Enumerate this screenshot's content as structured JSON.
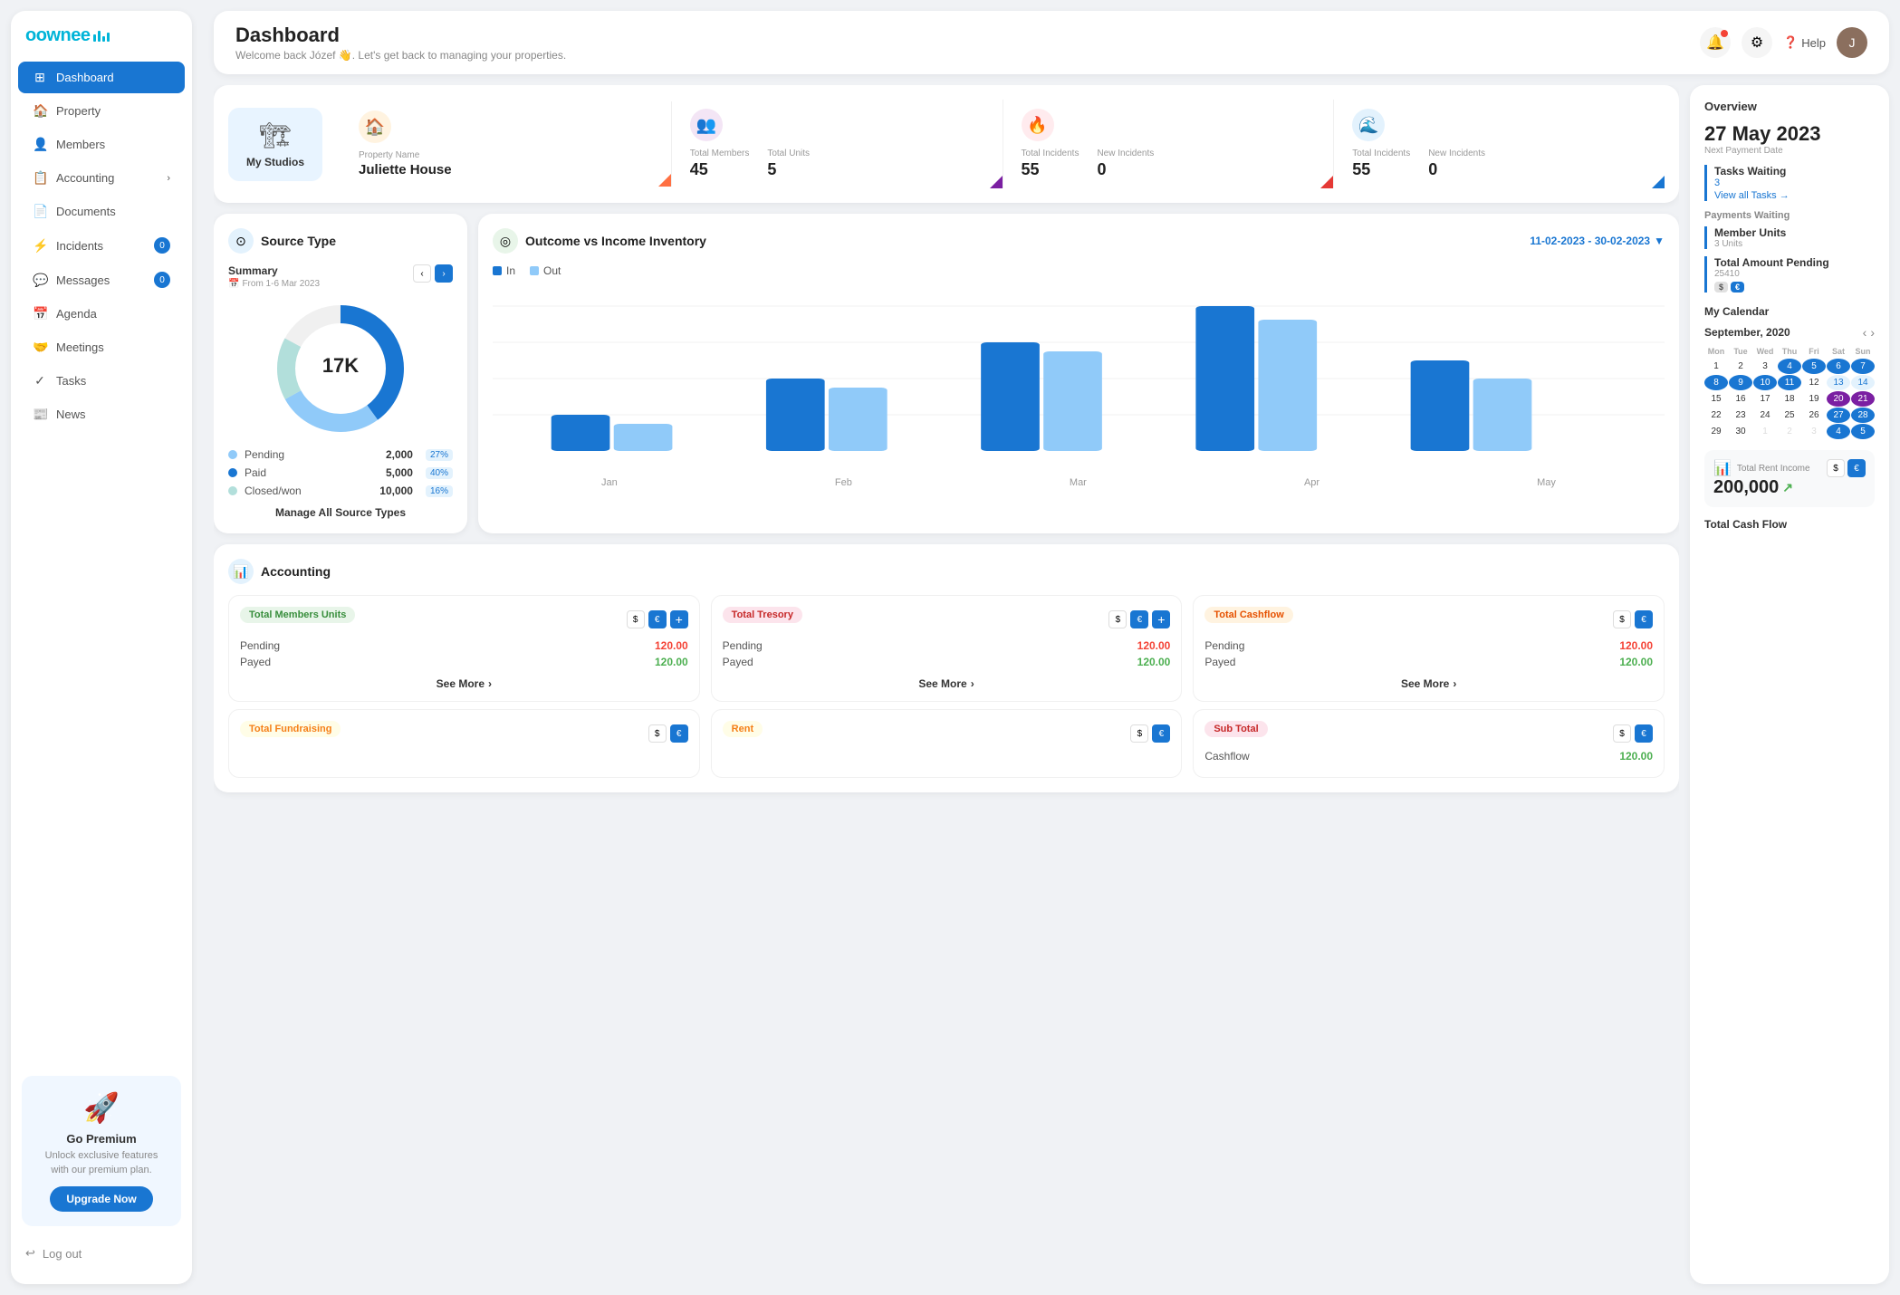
{
  "app": {
    "logo": "oownee",
    "logo_bars": "|||"
  },
  "header": {
    "title": "Dashboard",
    "subtitle": "Welcome back Józef 👋. Let's get back to managing your properties."
  },
  "sidebar": {
    "items": [
      {
        "label": "Dashboard",
        "icon": "⊞",
        "active": true,
        "badge": null
      },
      {
        "label": "Property",
        "icon": "🏠",
        "active": false,
        "badge": null
      },
      {
        "label": "Members",
        "icon": "👤",
        "active": false,
        "badge": null
      },
      {
        "label": "Accounting",
        "icon": "📋",
        "active": false,
        "badge": null,
        "arrow": ">"
      },
      {
        "label": "Documents",
        "icon": "📄",
        "active": false,
        "badge": null
      },
      {
        "label": "Incidents",
        "icon": "⚡",
        "active": false,
        "badge": "0"
      },
      {
        "label": "Messages",
        "icon": "💬",
        "active": false,
        "badge": "0"
      },
      {
        "label": "Agenda",
        "icon": "📅",
        "active": false,
        "badge": null
      },
      {
        "label": "Meetings",
        "icon": "🤝",
        "active": false,
        "badge": null
      },
      {
        "label": "Tasks",
        "icon": "✓",
        "active": false,
        "badge": null
      },
      {
        "label": "News",
        "icon": "📰",
        "active": false,
        "badge": null
      }
    ],
    "premium": {
      "title": "Go Premium",
      "description": "Unlock exclusive features with our premium plan.",
      "button": "Upgrade Now"
    },
    "logout": "Log out"
  },
  "property_row": {
    "my_studios": "My Studios",
    "cards": [
      {
        "icon": "🏠",
        "icon_color": "#ff7043",
        "label": "Property Name",
        "value": "Juliette House",
        "badge": "orange"
      },
      {
        "icon": "👥",
        "icon_color": "#7b1fa2",
        "label1": "Total Members",
        "label2": "Total Units",
        "value1": "45",
        "value2": "5",
        "badge": "purple"
      },
      {
        "icon": "🔥",
        "icon_color": "#e53935",
        "label1": "Total Incidents",
        "label2": "New Incidents",
        "value1": "55",
        "value2": "0",
        "badge": "red"
      },
      {
        "icon": "🌊",
        "icon_color": "#1976d2",
        "label1": "Total Incidents",
        "label2": "New Incidents",
        "value1": "55",
        "value2": "0",
        "badge": "blue"
      }
    ]
  },
  "source_type": {
    "title": "Source Type",
    "summary_label": "Summary",
    "date_range": "From 1-6 Mar 2023",
    "total": "17K",
    "items": [
      {
        "label": "Pending",
        "value": "2,000",
        "pct": "27%",
        "color": "#90caf9"
      },
      {
        "label": "Paid",
        "value": "5,000",
        "pct": "40%",
        "color": "#1976d2"
      },
      {
        "label": "Closed/won",
        "value": "10,000",
        "pct": "16%",
        "color": "#b2dfdb"
      }
    ],
    "manage_all": "Manage All Source Types"
  },
  "outcome_income": {
    "title": "Outcome vs Income Inventory",
    "date_range": "11-02-2023 - 30-02-2023",
    "legend": {
      "in": "In",
      "out": "Out"
    },
    "months": [
      "Jan",
      "Feb",
      "Mar",
      "Apr",
      "May"
    ],
    "bars": [
      {
        "month": "Jan",
        "in": 30,
        "out": 20
      },
      {
        "month": "Feb",
        "in": 55,
        "out": 50
      },
      {
        "month": "Mar",
        "in": 75,
        "out": 65
      },
      {
        "month": "Apr",
        "in": 95,
        "out": 85
      },
      {
        "month": "May",
        "in": 55,
        "out": 45
      }
    ]
  },
  "accounting": {
    "title": "Accounting",
    "sub_cards": [
      {
        "tag": "Total Members Units",
        "tag_class": "tag-green",
        "rows": [
          {
            "label": "Pending",
            "amount": "120.00",
            "color": "red"
          },
          {
            "label": "Payed",
            "amount": "120.00",
            "color": "green"
          }
        ],
        "see_more": "See More"
      },
      {
        "tag": "Total Tresory",
        "tag_class": "tag-pink",
        "rows": [
          {
            "label": "Pending",
            "amount": "120.00",
            "color": "red"
          },
          {
            "label": "Payed",
            "amount": "120.00",
            "color": "green"
          }
        ],
        "see_more": "See More"
      },
      {
        "tag": "Total Cashflow",
        "tag_class": "tag-orange",
        "rows": [
          {
            "label": "Pending",
            "amount": "120.00",
            "color": "red"
          },
          {
            "label": "Payed",
            "amount": "120.00",
            "color": "green"
          }
        ],
        "see_more": "See More"
      }
    ],
    "sub_cards2": [
      {
        "tag": "Total Fundraising",
        "tag_class": "tag-yellow"
      },
      {
        "tag": "Rent",
        "tag_class": "tag-yellow"
      },
      {
        "tag": "Sub Total",
        "tag_class": "tag-pink"
      }
    ]
  },
  "right_panel": {
    "overview_title": "Overview",
    "date": "27 May 2023",
    "next_payment_label": "Next Payment Date",
    "tasks": {
      "title": "Tasks Waiting",
      "count": "3",
      "view_all": "View all Tasks →"
    },
    "payments_title": "Payments Waiting",
    "payment_items": [
      {
        "name": "Member Units",
        "sub": "3 Units"
      },
      {
        "name": "Total Amount Pending",
        "sub": "25410",
        "badges": [
          "$",
          "€"
        ]
      }
    ],
    "calendar": {
      "title": "My Calendar",
      "month": "September, 2020",
      "day_headers": [
        "Mon",
        "Tue",
        "Wed",
        "Thu",
        "Fri",
        "Sat",
        "Sun"
      ],
      "weeks": [
        [
          "",
          "",
          "1",
          "2",
          "3",
          "4",
          "5",
          "6",
          "7"
        ],
        [
          "8",
          "9",
          "10",
          "11",
          "12",
          "13",
          "14"
        ],
        [
          "15",
          "16",
          "17",
          "18",
          "19",
          "20",
          "21"
        ],
        [
          "22",
          "23",
          "24",
          "25",
          "26",
          "27",
          "28"
        ],
        [
          "29",
          "30",
          "1",
          "2",
          "3",
          "4",
          "5"
        ]
      ],
      "highlighted": [
        "4",
        "5",
        "6",
        "7",
        "8",
        "9",
        "10",
        "11",
        "13",
        "14",
        "20",
        "21",
        "27",
        "28",
        "4",
        "5"
      ]
    },
    "total_rent": {
      "label": "Total Rent Income",
      "amount": "200,000",
      "controls": [
        "$",
        "€"
      ]
    },
    "cash_flow_title": "Total Cash Flow"
  }
}
